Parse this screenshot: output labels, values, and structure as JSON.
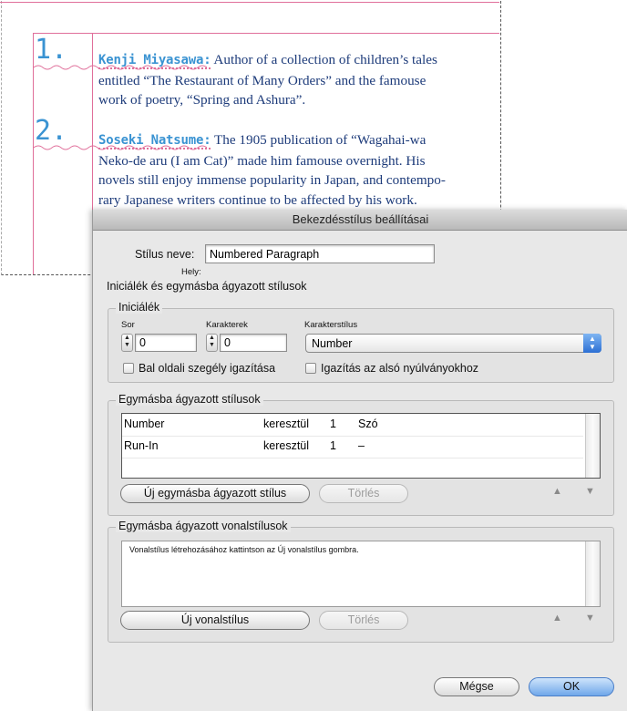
{
  "document": {
    "entries": [
      {
        "number": "1.",
        "name": "Kenji Miyasawa:",
        "lines": [
          "Author of a collection of children’s tales",
          "entitled “The Restaurant of Many Orders” and the famouse",
          "work of poetry, “Spring and Ashura”."
        ]
      },
      {
        "number": "2.",
        "name": "Soseki Natsume:",
        "lines": [
          "The 1905 publication of “Wagahai-wa",
          "Neko-de aru (I am Cat)” made him famouse overnight. His",
          "novels still enjoy immense popularity in Japan, and contempo-",
          "rary Japanese writers continue to be affected by his work."
        ]
      }
    ]
  },
  "dialog": {
    "title": "Bekezdésstílus beállításai",
    "style_name_label": "Stílus neve:",
    "style_name_value": "Numbered Paragraph",
    "location_label": "Hely:",
    "section_title": "Iniciálék és egymásba ágyazott stílusok",
    "drop_caps": {
      "group_title": "Iniciálék",
      "lines_label": "Sor",
      "lines_value": "0",
      "chars_label": "Karakterek",
      "chars_value": "0",
      "char_style_label": "Karakterstílus",
      "char_style_value": "Number",
      "align_left_label": "Bal oldali szegély igazítása",
      "scale_descenders_label": "Igazítás az alsó nyúlványokhoz"
    },
    "nested_styles": {
      "group_title": "Egymásba ágyazott stílusok",
      "rows": [
        {
          "style": "Number",
          "through": "keresztül",
          "count": "1",
          "end": "Szó"
        },
        {
          "style": "Run-In",
          "through": "keresztül",
          "count": "1",
          "end": "–"
        }
      ],
      "new_button": "Új egymásba ágyazott stílus",
      "delete_button": "Törlés"
    },
    "nested_line_styles": {
      "group_title": "Egymásba ágyazott vonalstílusok",
      "hint": "Vonalstílus létrehozásához kattintson az Új vonalstílus gombra.",
      "new_button": "Új vonalstílus",
      "delete_button": "Törlés"
    },
    "cancel_button": "Mégse",
    "ok_button": "OK",
    "up_arrow": "▲",
    "down_arrow": "▼"
  },
  "colors": {
    "accent": "#3a93d2",
    "text": "#1d3b7a",
    "margin_guide": "#e06f9a",
    "default_button": "#6fa7ea"
  }
}
